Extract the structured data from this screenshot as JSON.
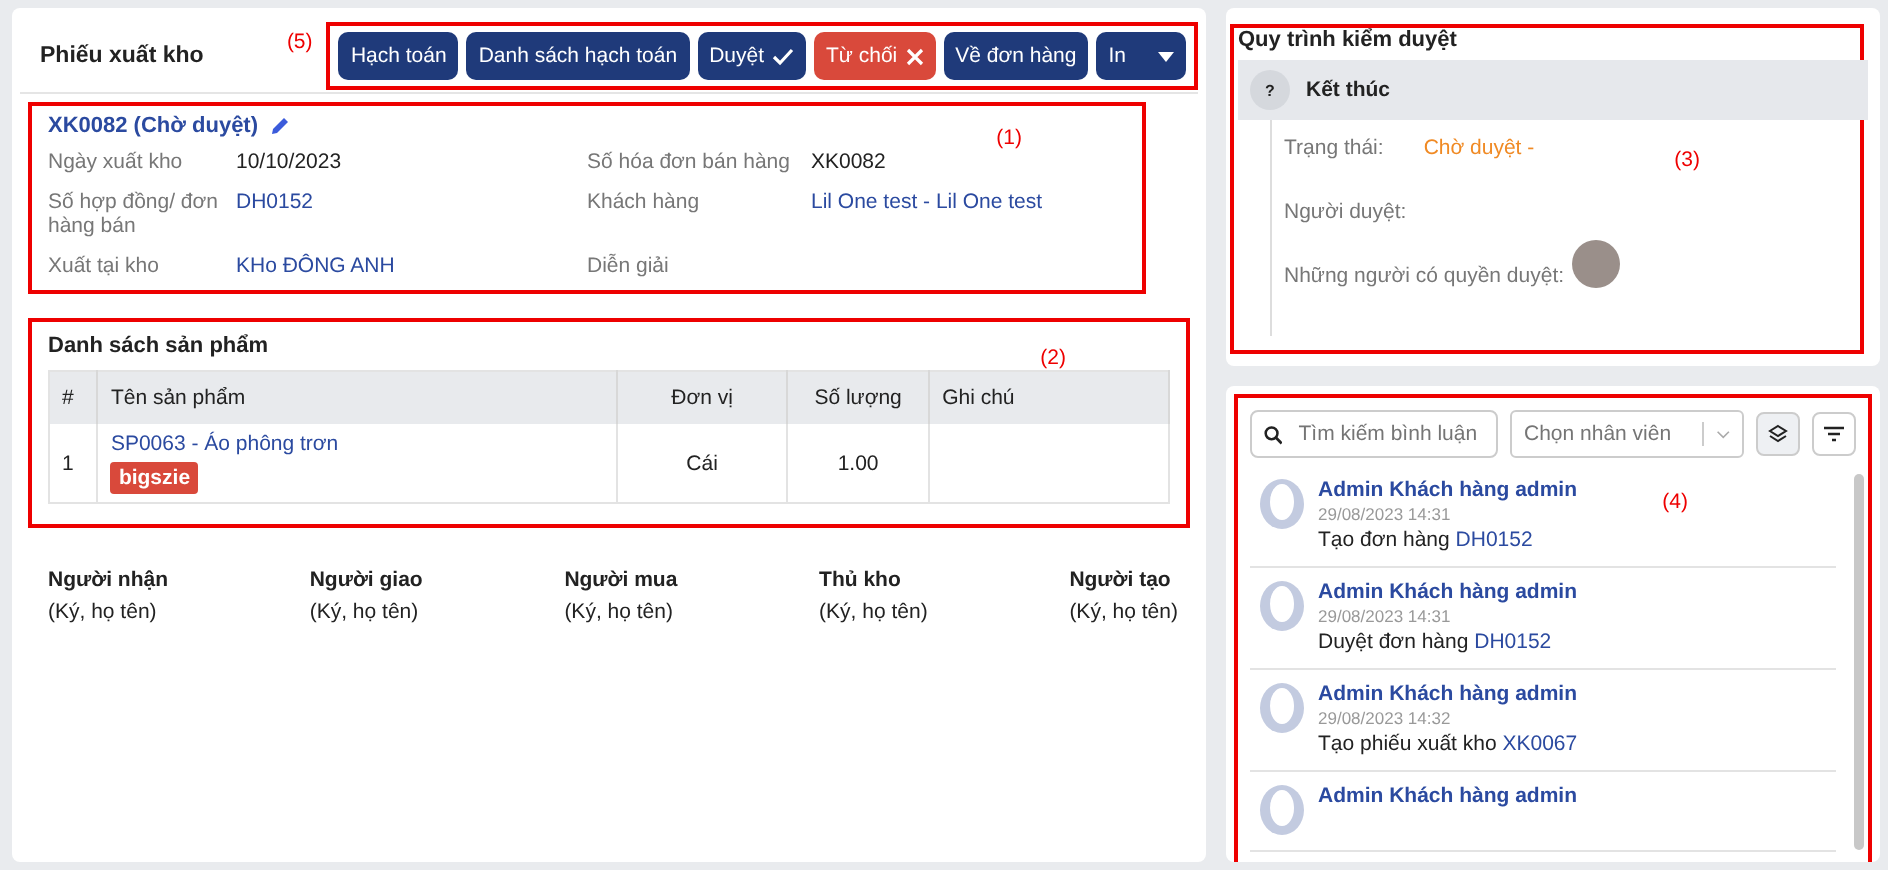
{
  "header": {
    "title": "Phiếu xuất kho",
    "note": "(5)",
    "buttons": [
      {
        "label": "Hạch toán",
        "kind": "primary"
      },
      {
        "label": "Danh sách hạch toán",
        "kind": "primary"
      },
      {
        "label": "Duyệt",
        "kind": "approve"
      },
      {
        "label": "Từ chối",
        "kind": "reject"
      },
      {
        "label": "Về đơn hàng",
        "kind": "primary"
      },
      {
        "label": "In",
        "kind": "dropdown"
      }
    ]
  },
  "info": {
    "note": "(1)",
    "code": "XK0082 (Chờ duyệt)",
    "fields": [
      {
        "label": "Ngày xuất kho",
        "value": "10/10/2023",
        "kind": "text"
      },
      {
        "label": "Số hóa đơn bán hàng",
        "value": "XK0082",
        "kind": "text"
      },
      {
        "label": "Số hợp đồng/ đơn hàng bán",
        "value": "DH0152",
        "kind": "link"
      },
      {
        "label": "Khách hàng",
        "value": "Lil One test - Lil One test",
        "kind": "link"
      },
      {
        "label": "Xuất tại kho",
        "value": "KHo ĐÔNG ANH",
        "kind": "link"
      },
      {
        "label": "Diễn giải"
      }
    ]
  },
  "products": {
    "title": "Danh sách sản phẩm",
    "note": "(2)",
    "columns": [
      "#",
      "Tên sản phẩm",
      "Đơn vị",
      "Số lượng",
      "Ghi chú"
    ],
    "rows": [
      {
        "index": "1",
        "name": "SP0063 - Áo phông trơn",
        "tag": "bigszie",
        "unit": "Cái",
        "quantity": "1.00"
      }
    ]
  },
  "signatures": [
    {
      "role": "Người nhận",
      "hint": "(Ký, họ tên)"
    },
    {
      "role": "Người giao",
      "hint": "(Ký, họ tên)"
    },
    {
      "role": "Người mua",
      "hint": "(Ký, họ tên)"
    },
    {
      "role": "Thủ kho",
      "hint": "(Ký, họ tên)"
    },
    {
      "role": "Người tạo",
      "hint": "(Ký, họ tên)"
    }
  ],
  "approval": {
    "title": "Quy trình kiểm duyệt",
    "note": "(3)",
    "step": {
      "icon": "?",
      "title": "Kết thúc"
    },
    "status_label": "Trạng thái:",
    "status": "Chờ duyệt -",
    "approver_label": "Người duyệt:",
    "permitted_label": "Những người có quyền duyệt:"
  },
  "comments": {
    "note": "(4)",
    "search": {
      "placeholder": "Tìm kiếm bình luận"
    },
    "employee": {
      "placeholder": "Chọn nhân viên"
    },
    "items": [
      {
        "author": "Admin Khách hàng admin",
        "time": "29/08/2023 14:31",
        "text": "Tạo đơn hàng",
        "ref": "DH0152"
      },
      {
        "author": "Admin Khách hàng admin",
        "time": "29/08/2023 14:31",
        "text": "Duyệt đơn hàng",
        "ref": "DH0152"
      },
      {
        "author": "Admin Khách hàng admin",
        "time": "29/08/2023 14:32",
        "text": "Tạo phiếu xuất kho",
        "ref": "XK0067"
      },
      {
        "author": "Admin Khách hàng admin"
      }
    ]
  }
}
